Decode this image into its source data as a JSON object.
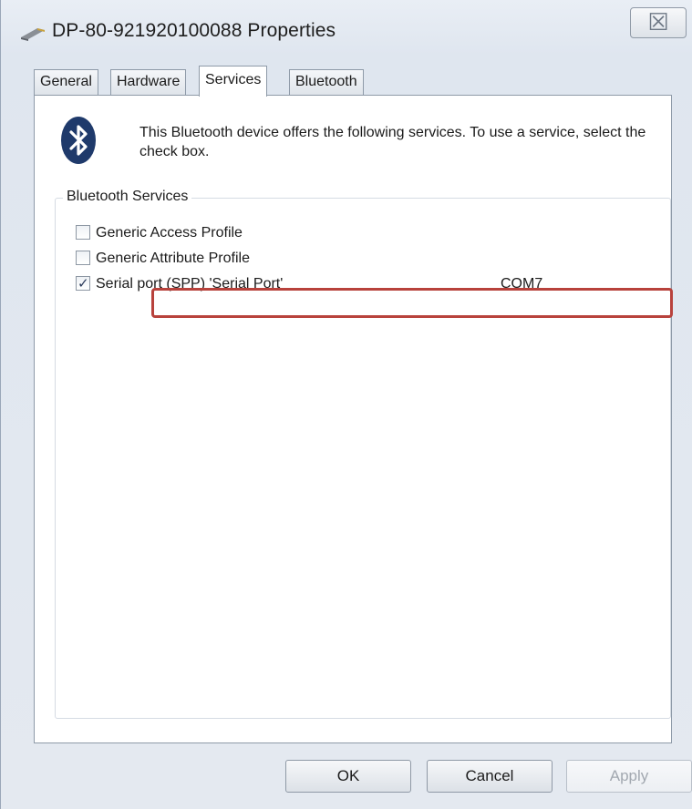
{
  "window": {
    "title": "DP-80-921920100088 Properties",
    "close_glyph": "☒"
  },
  "tabs": [
    {
      "label": "General",
      "active": false
    },
    {
      "label": "Hardware",
      "active": false
    },
    {
      "label": "Services",
      "active": true
    },
    {
      "label": "Bluetooth",
      "active": false
    }
  ],
  "services_tab": {
    "intro": "This Bluetooth device offers the following services. To use a service, select the check box.",
    "group_label": "Bluetooth Services",
    "services": [
      {
        "label": "Generic Access Profile",
        "checked": false,
        "port": ""
      },
      {
        "label": "Generic Attribute Profile",
        "checked": false,
        "port": ""
      },
      {
        "label": "Serial port (SPP) 'Serial Port'",
        "checked": true,
        "port": "COM7"
      }
    ]
  },
  "buttons": {
    "ok": "OK",
    "cancel": "Cancel",
    "apply": "Apply"
  },
  "colors": {
    "highlight": "#b8423c",
    "bluetooth_icon": "#1f3a6b"
  }
}
